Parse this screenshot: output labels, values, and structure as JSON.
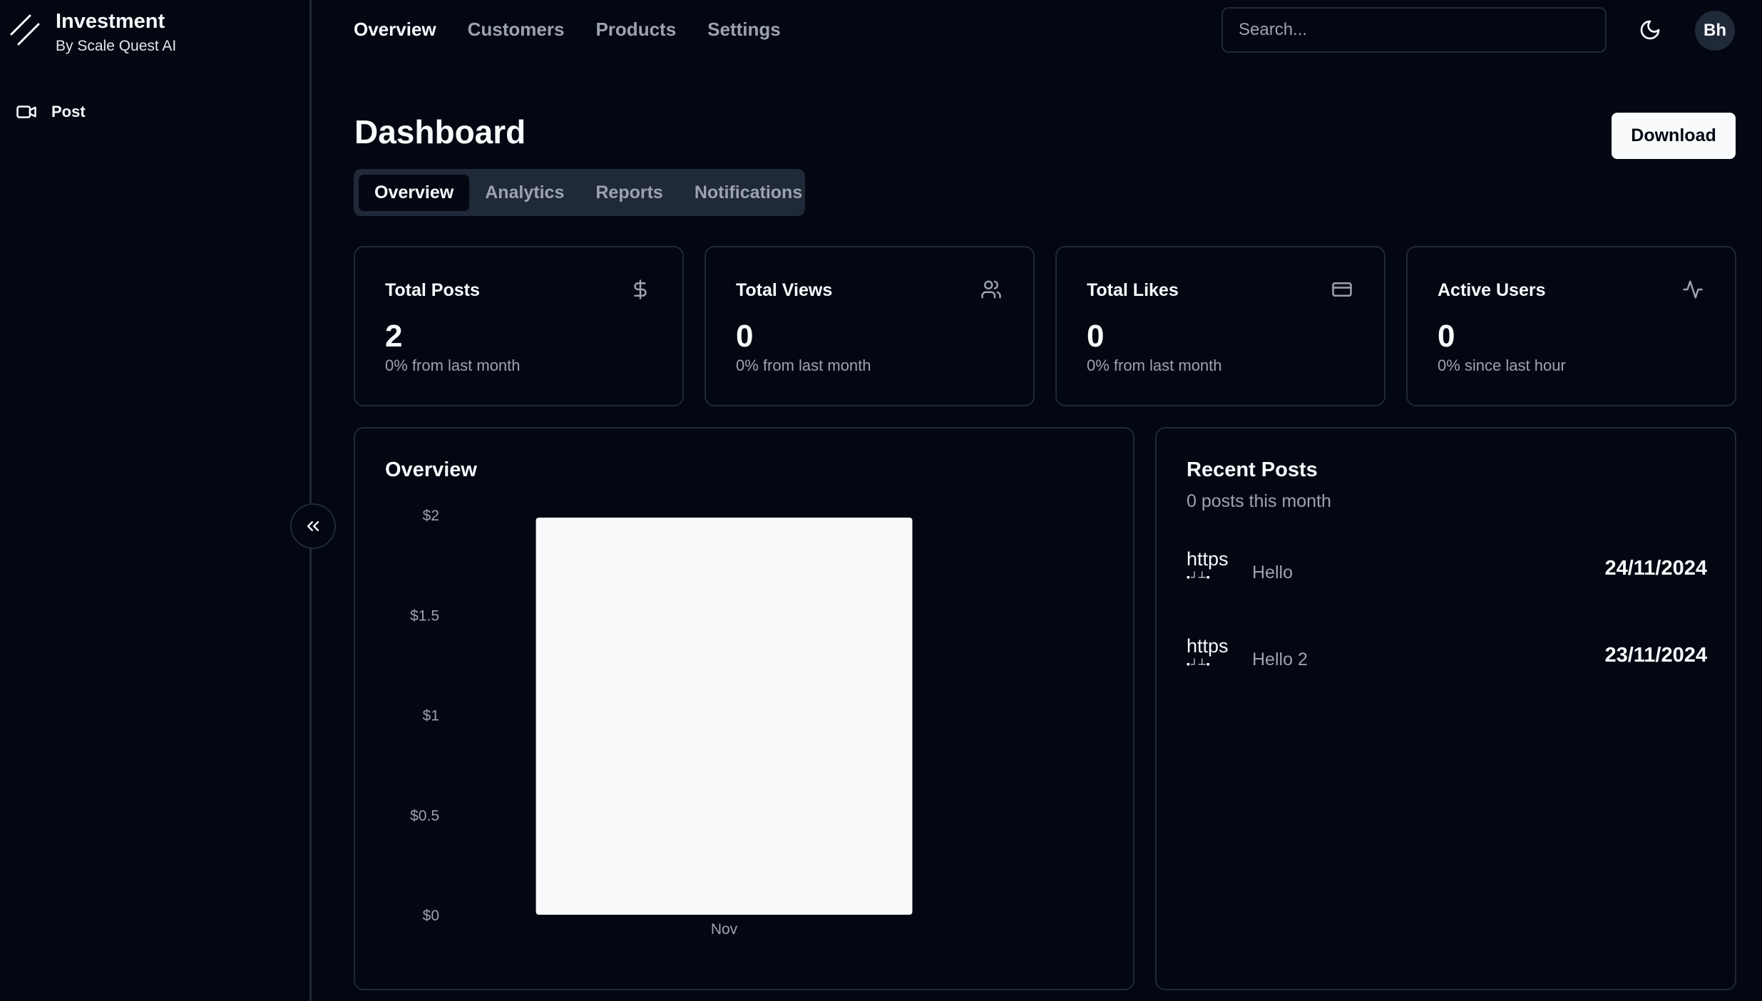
{
  "brand": {
    "title": "Investment",
    "subtitle": "By Scale Quest AI"
  },
  "sidebar": {
    "items": [
      {
        "label": "Post",
        "icon": "video-icon"
      }
    ]
  },
  "topnav": {
    "items": [
      "Overview",
      "Customers",
      "Products",
      "Settings"
    ],
    "active": "Overview"
  },
  "search": {
    "placeholder": "Search...",
    "value": ""
  },
  "user": {
    "initials": "Bh"
  },
  "header": {
    "title": "Dashboard",
    "download_label": "Download"
  },
  "tabs": {
    "items": [
      "Overview",
      "Analytics",
      "Reports",
      "Notifications"
    ],
    "active": "Overview"
  },
  "stats": [
    {
      "title": "Total Posts",
      "value": "2",
      "sub": "0% from last month",
      "icon": "dollar-icon"
    },
    {
      "title": "Total Views",
      "value": "0",
      "sub": "0% from last month",
      "icon": "users-icon"
    },
    {
      "title": "Total Likes",
      "value": "0",
      "sub": "0% from last month",
      "icon": "credit-card-icon"
    },
    {
      "title": "Active Users",
      "value": "0",
      "sub": "0% since last hour",
      "icon": "activity-icon"
    }
  ],
  "overview": {
    "title": "Overview"
  },
  "chart_data": {
    "type": "bar",
    "title": "",
    "categories": [
      "Nov"
    ],
    "values": [
      2
    ],
    "ylim": [
      0,
      2
    ],
    "yticks": [
      0,
      0.5,
      1,
      1.5,
      2
    ],
    "ytick_labels": [
      "$0",
      "$0.5",
      "$1",
      "$1.5",
      "$2"
    ],
    "xlabel": "",
    "ylabel": "",
    "grid": false,
    "bar_color": "#f8fafc"
  },
  "recent_posts": {
    "title": "Recent Posts",
    "subtitle": "0 posts this month",
    "items": [
      {
        "thumb_alt": "https",
        "title": "Hello",
        "date": "24/11/2024"
      },
      {
        "thumb_alt": "https",
        "title": "Hello 2",
        "date": "23/11/2024"
      }
    ]
  },
  "colors": {
    "background": "#030712",
    "border": "#1f2937",
    "muted": "#9ca3af",
    "foreground": "#f8fafc"
  }
}
